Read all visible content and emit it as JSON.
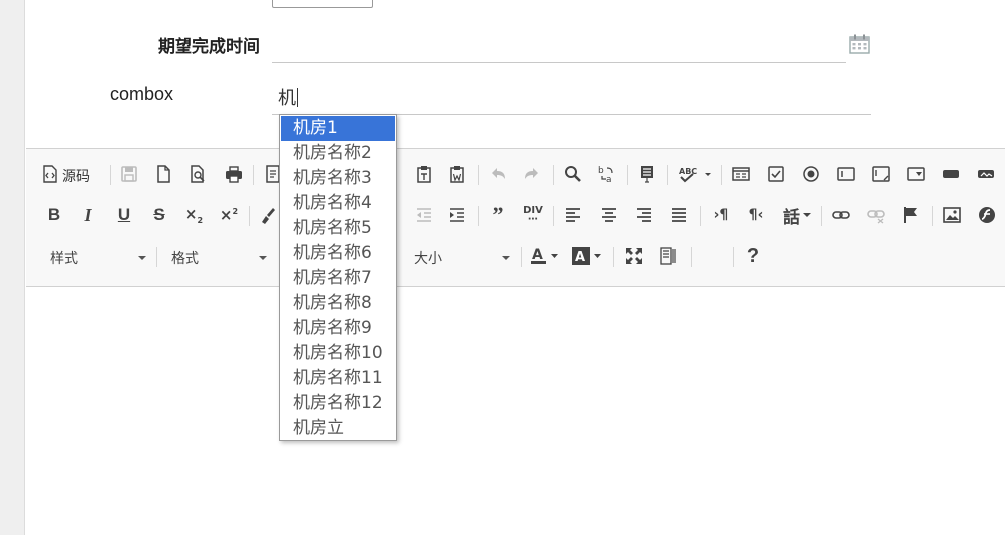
{
  "form": {
    "date_label": "期望完成时间",
    "date_value": "",
    "combo_label": "combox",
    "combo_value": "机"
  },
  "dropdown": {
    "selected_index": 0,
    "options": [
      "机房1",
      "机房名称2",
      "机房名称3",
      "机房名称4",
      "机房名称5",
      "机房名称6",
      "机房名称7",
      "机房名称8",
      "机房名称9",
      "机房名称10",
      "机房名称11",
      "机房名称12",
      "机房立"
    ]
  },
  "toolbar": {
    "source_label": "源码",
    "styles_label": "样式",
    "format_label": "格式",
    "size_label": "大小",
    "help_label": "?"
  }
}
